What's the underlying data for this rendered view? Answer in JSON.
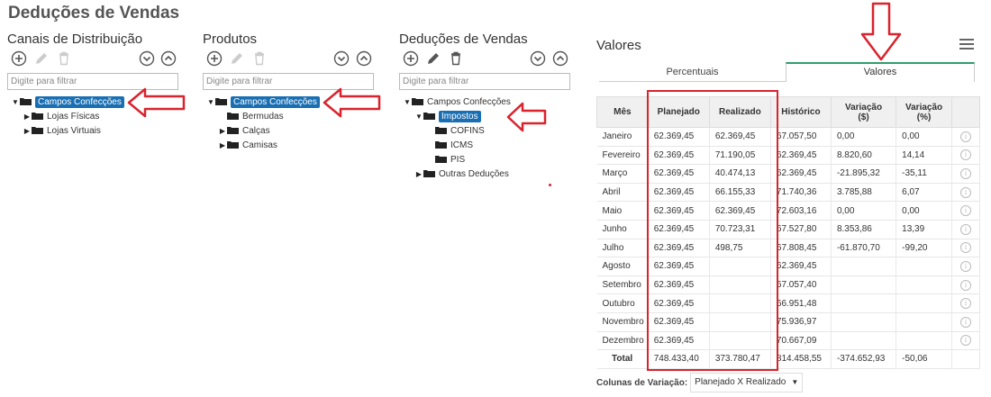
{
  "page_title": "Deduções de Vendas",
  "panels": [
    {
      "title": "Canais de Distribuição",
      "filter_placeholder": "Digite para filtrar",
      "tree": [
        {
          "label": "Campos Confecções",
          "level": 0,
          "expanded": true,
          "selected": true
        },
        {
          "label": "Lojas Físicas",
          "level": 1,
          "expanded": false,
          "selected": false
        },
        {
          "label": "Lojas Virtuais",
          "level": 1,
          "expanded": false,
          "selected": false
        }
      ]
    },
    {
      "title": "Produtos",
      "filter_placeholder": "Digite para filtrar",
      "tree": [
        {
          "label": "Campos Confecções",
          "level": 0,
          "expanded": true,
          "selected": true
        },
        {
          "label": "Bermudas",
          "level": 1,
          "leaf": true,
          "selected": false
        },
        {
          "label": "Calças",
          "level": 1,
          "expanded": false,
          "selected": false
        },
        {
          "label": "Camisas",
          "level": 1,
          "expanded": false,
          "selected": false
        }
      ]
    },
    {
      "title": "Deduções de Vendas",
      "filter_placeholder": "Digite para filtrar",
      "tree": [
        {
          "label": "Campos Confecções",
          "level": 0,
          "expanded": true,
          "selected": false
        },
        {
          "label": "Impostos",
          "level": 1,
          "expanded": true,
          "selected": true
        },
        {
          "label": "COFINS",
          "level": 2,
          "leaf": true,
          "selected": false
        },
        {
          "label": "ICMS",
          "level": 2,
          "leaf": true,
          "selected": false
        },
        {
          "label": "PIS",
          "level": 2,
          "leaf": true,
          "selected": false
        },
        {
          "label": "Outras Deduções",
          "level": 1,
          "expanded": false,
          "selected": false
        }
      ]
    }
  ],
  "valores": {
    "title": "Valores",
    "tabs": [
      {
        "label": "Percentuais",
        "active": false
      },
      {
        "label": "Valores",
        "active": true
      }
    ],
    "columns": [
      "Mês",
      "Planejado",
      "Realizado",
      "Histórico",
      "Variação ($)",
      "Variação (%)"
    ],
    "column_lines": [
      [
        "Mês"
      ],
      [
        "Planejado"
      ],
      [
        "Realizado"
      ],
      [
        "Histórico"
      ],
      [
        "Variação",
        "($)"
      ],
      [
        "Variação",
        "(%)"
      ]
    ],
    "rows": [
      {
        "mes": "Janeiro",
        "planejado": "62.369,45",
        "realizado": "62.369,45",
        "historico": "67.057,50",
        "var_valor": "0,00",
        "var_pct": "0,00",
        "sign": "zero"
      },
      {
        "mes": "Fevereiro",
        "planejado": "62.369,45",
        "realizado": "71.190,05",
        "historico": "62.369,45",
        "var_valor": "8.820,60",
        "var_pct": "14,14",
        "sign": "pos"
      },
      {
        "mes": "Março",
        "planejado": "62.369,45",
        "realizado": "40.474,13",
        "historico": "62.369,45",
        "var_valor": "-21.895,32",
        "var_pct": "-35,11",
        "sign": "neg"
      },
      {
        "mes": "Abril",
        "planejado": "62.369,45",
        "realizado": "66.155,33",
        "historico": "71.740,36",
        "var_valor": "3.785,88",
        "var_pct": "6,07",
        "sign": "pos"
      },
      {
        "mes": "Maio",
        "planejado": "62.369,45",
        "realizado": "62.369,45",
        "historico": "72.603,16",
        "var_valor": "0,00",
        "var_pct": "0,00",
        "sign": "zero"
      },
      {
        "mes": "Junho",
        "planejado": "62.369,45",
        "realizado": "70.723,31",
        "historico": "67.527,80",
        "var_valor": "8.353,86",
        "var_pct": "13,39",
        "sign": "pos"
      },
      {
        "mes": "Julho",
        "planejado": "62.369,45",
        "realizado": "498,75",
        "historico": "67.808,45",
        "var_valor": "-61.870,70",
        "var_pct": "-99,20",
        "sign": "neg"
      },
      {
        "mes": "Agosto",
        "planejado": "62.369,45",
        "realizado": "",
        "historico": "62.369,45",
        "var_valor": "",
        "var_pct": "",
        "sign": "zero"
      },
      {
        "mes": "Setembro",
        "planejado": "62.369,45",
        "realizado": "",
        "historico": "67.057,40",
        "var_valor": "",
        "var_pct": "",
        "sign": "zero"
      },
      {
        "mes": "Outubro",
        "planejado": "62.369,45",
        "realizado": "",
        "historico": "66.951,48",
        "var_valor": "",
        "var_pct": "",
        "sign": "zero"
      },
      {
        "mes": "Novembro",
        "planejado": "62.369,45",
        "realizado": "",
        "historico": "75.936,97",
        "var_valor": "",
        "var_pct": "",
        "sign": "zero"
      },
      {
        "mes": "Dezembro",
        "planejado": "62.369,45",
        "realizado": "",
        "historico": "70.667,09",
        "var_valor": "",
        "var_pct": "",
        "sign": "zero"
      }
    ],
    "total": {
      "mes": "Total",
      "planejado": "748.433,40",
      "realizado": "373.780,47",
      "historico": "814.458,55",
      "var_valor": "-374.652,93",
      "var_pct": "-50,06"
    },
    "footer": {
      "label": "Colunas de Variação:",
      "selected": "Planejado X Realizado"
    }
  },
  "colors": {
    "selection": "#1a6fb3",
    "annotation_red": "#d9232d",
    "positive_variation": "#d0303a",
    "negative_variation": "#2b8a2b",
    "tab_accent": "#2e9e6b"
  },
  "icons": [
    "add-icon",
    "edit-icon",
    "delete-icon",
    "collapse-all-icon",
    "expand-all-icon",
    "folder-icon",
    "menu-icon",
    "info-icon"
  ]
}
